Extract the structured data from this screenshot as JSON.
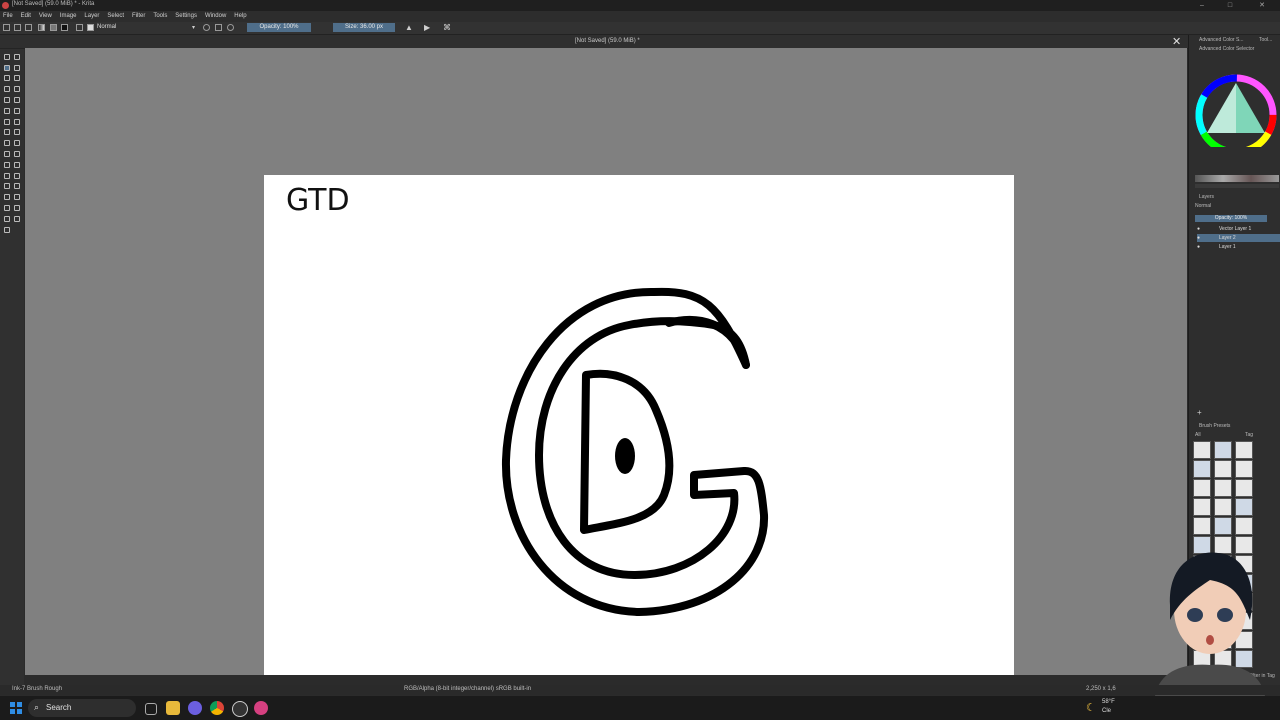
{
  "window": {
    "title": "[Not Saved]  (59.0 MiB) * - Krita"
  },
  "menu": [
    "File",
    "Edit",
    "View",
    "Image",
    "Layer",
    "Select",
    "Filter",
    "Tools",
    "Settings",
    "Window",
    "Help"
  ],
  "toolbar": {
    "blend_mode": "Normal",
    "opacity": "Opacity: 100%",
    "size": "Size: 36.00 px"
  },
  "document": {
    "tab_label": "[Not Saved]  (59.0 MiB) *",
    "canvas_text": "GTD"
  },
  "dock": {
    "tabs": [
      "Advanced Color S...",
      "Tool..."
    ],
    "color_selector_title": "Advanced Color Selector",
    "layers_title": "Layers",
    "layer_blend": "Normal",
    "layer_opacity": "Opacity: 100%",
    "layers": [
      "Vector Layer 1",
      "Layer 2",
      "Layer 1"
    ],
    "brush_presets_title": "Brush Presets",
    "brush_filter": "All",
    "brush_tag": "Tag",
    "filter_in_tag": "Filter in Tag"
  },
  "status": {
    "brush": "Ink-7 Brush Rough",
    "color_info": "RGB/Alpha (8-bit integer/channel)  sRGB built-in",
    "coords": "2,250 x 1,6"
  },
  "taskbar": {
    "search_label": "Search",
    "weather_temp": "58°F",
    "weather_text": "Cle"
  },
  "colors": {
    "accent": "#4f6e8a",
    "canvas_bg": "#808080",
    "paper": "#ffffff"
  }
}
